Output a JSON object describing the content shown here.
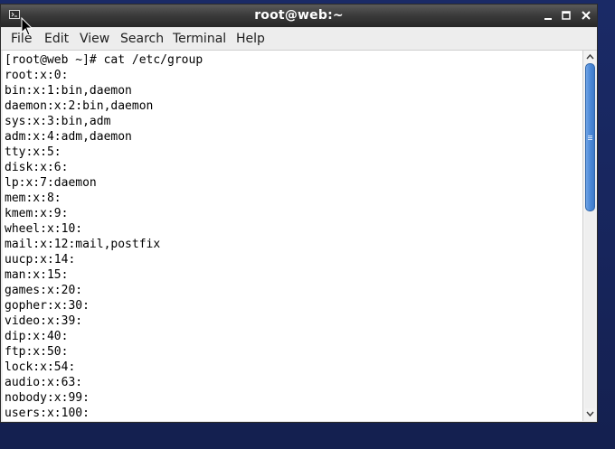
{
  "window": {
    "title": "root@web:~"
  },
  "menu": {
    "items": [
      "File",
      "Edit",
      "View",
      "Search",
      "Terminal",
      "Help"
    ]
  },
  "terminal": {
    "lines": [
      "[root@web ~]# cat /etc/group",
      "root:x:0:",
      "bin:x:1:bin,daemon",
      "daemon:x:2:bin,daemon",
      "sys:x:3:bin,adm",
      "adm:x:4:adm,daemon",
      "tty:x:5:",
      "disk:x:6:",
      "lp:x:7:daemon",
      "mem:x:8:",
      "kmem:x:9:",
      "wheel:x:10:",
      "mail:x:12:mail,postfix",
      "uucp:x:14:",
      "man:x:15:",
      "games:x:20:",
      "gopher:x:30:",
      "video:x:39:",
      "dip:x:40:",
      "ftp:x:50:",
      "lock:x:54:",
      "audio:x:63:",
      "nobody:x:99:",
      "users:x:100:"
    ]
  },
  "scrollbar": {
    "position_fraction": 0.0,
    "visible_fraction": 0.43
  },
  "colors": {
    "desktop": "#1a2a66",
    "titlebar": "#3c3c3c",
    "menubar": "#ededed",
    "terminal_bg": "#ffffff",
    "terminal_fg": "#000000",
    "scroll_thumb": "#4d8ad8"
  },
  "icons": {
    "app": "terminal-icon",
    "minimize": "minimize-icon",
    "maximize": "maximize-icon",
    "close": "close-icon",
    "scroll_up": "arrow-up-icon",
    "scroll_down": "arrow-down-icon",
    "pointer": "mouse-pointer-icon"
  }
}
